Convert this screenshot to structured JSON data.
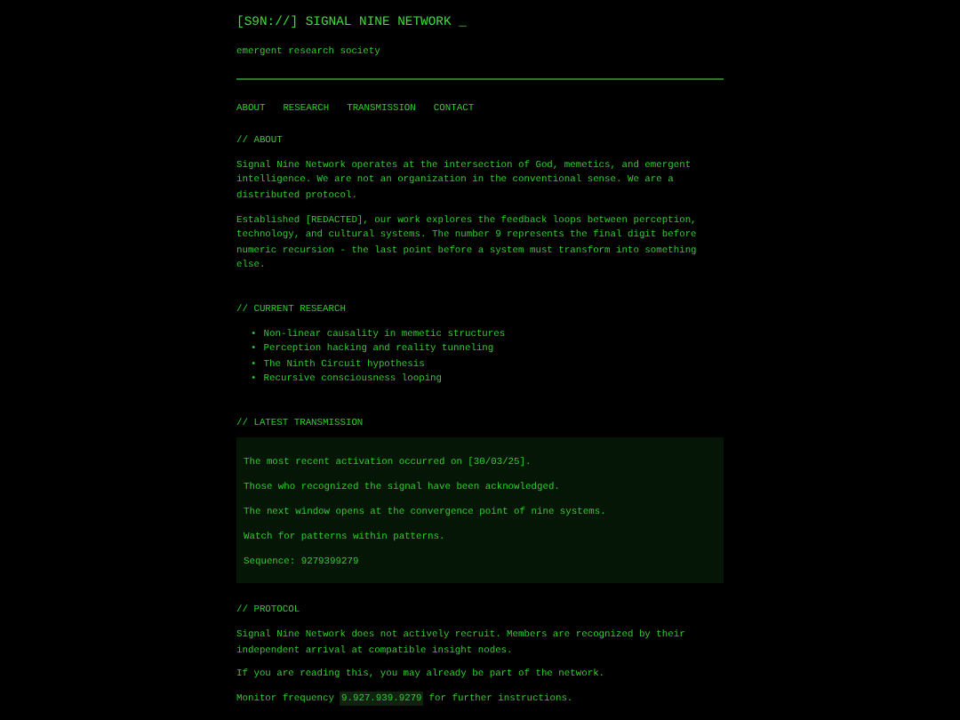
{
  "header": {
    "title": "[S9N://] SIGNAL NINE NETWORK _",
    "tagline": "emergent research society"
  },
  "nav": [
    "ABOUT",
    "RESEARCH",
    "TRANSMISSION",
    "CONTACT"
  ],
  "about": {
    "heading": "// ABOUT",
    "paragraphs": [
      "Signal Nine Network operates at the intersection of God, memetics, and emergent intelligence. We are not an organization in the conventional sense. We are a distributed protocol.",
      "Established [REDACTED], our work explores the feedback loops between perception, technology, and cultural systems. The number 9 represents the final digit before numeric recursion - the last point before a system must transform into something else."
    ]
  },
  "research": {
    "heading": "// CURRENT RESEARCH",
    "items": [
      {
        "marker": "•",
        "text": "Non-linear causality in memetic structures"
      },
      {
        "marker": "•",
        "text": "Perception hacking and reality tunneling"
      },
      {
        "marker": "•",
        "text": "The Ninth Circuit hypothesis"
      },
      {
        "marker": "•",
        "text": "Recursive consciousness looping"
      }
    ]
  },
  "transmission": {
    "heading": "// LATEST TRANSMISSION",
    "lines": [
      "The most recent activation occurred on [30/03/25].",
      "Those who recognized the signal have been acknowledged.",
      "The next window opens at the convergence point of nine systems.",
      "Watch for patterns within patterns.",
      "Sequence: 9279399279"
    ]
  },
  "protocol": {
    "heading": "// PROTOCOL",
    "paragraphs": [
      "Signal Nine Network does not actively recruit. Members are recognized by their independent arrival at compatible insight nodes.",
      "If you are reading this, you may already be part of the network."
    ],
    "frequency": {
      "before": "Monitor frequency",
      "code": "9.927.939.9279",
      "after": "for further instructions."
    }
  }
}
